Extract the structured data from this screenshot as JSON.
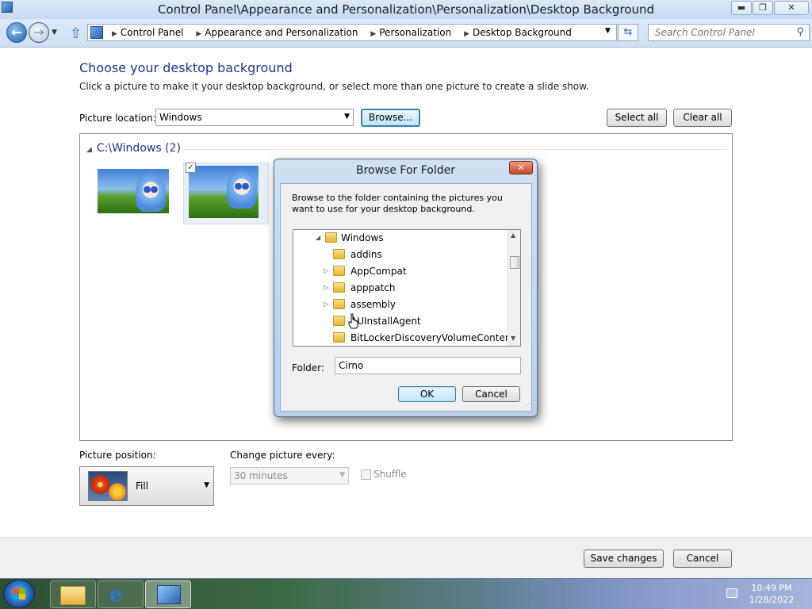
{
  "window": {
    "title": "Control Panel\\Appearance and Personalization\\Personalization\\Desktop Background",
    "min_glyph": "▬",
    "max_glyph": "❐",
    "close_glyph": "✕"
  },
  "nav": {
    "back_glyph": "←",
    "forward_glyph": "→",
    "breadcrumbs": [
      "Control Panel",
      "Appearance and Personalization",
      "Personalization",
      "Desktop Background"
    ],
    "search_placeholder": "Search Control Panel"
  },
  "page": {
    "heading": "Choose your desktop background",
    "subheading": "Click a picture to make it your desktop background, or select more than one picture to create a slide show.",
    "picture_location_label": "Picture location:",
    "picture_location_value": "Windows",
    "browse_label": "Browse...",
    "select_all_label": "Select all",
    "clear_all_label": "Clear all",
    "group_header": "C:\\Windows (2)",
    "picture_position_label": "Picture position:",
    "picture_position_value": "Fill",
    "change_every_label": "Change picture every:",
    "change_every_value": "30 minutes",
    "shuffle_label": "Shuffle",
    "save_label": "Save changes",
    "cancel_label": "Cancel"
  },
  "dialog": {
    "title": "Browse For Folder",
    "close_glyph": "✕",
    "description": "Browse to the folder containing the pictures you want to use for your desktop background.",
    "tree": [
      {
        "label": "Windows",
        "expander": "◢"
      },
      {
        "label": "addins",
        "expander": ""
      },
      {
        "label": "AppCompat",
        "expander": "▷"
      },
      {
        "label": "apppatch",
        "expander": "▷"
      },
      {
        "label": "assembly",
        "expander": "▷"
      },
      {
        "label": "AUInstallAgent",
        "expander": ""
      },
      {
        "label": "BitLockerDiscoveryVolumeContents",
        "expander": ""
      }
    ],
    "folder_label": "Folder:",
    "folder_value": "Cirno",
    "ok_label": "OK",
    "cancel_label": "Cancel"
  },
  "taskbar": {
    "ie_glyph": "e",
    "clock_time": "10:49 PM",
    "clock_date": "1/28/2022"
  },
  "colors": {
    "heading": "#1e3287",
    "accent_button_border": "#3c7fb1",
    "dialog_frame": "#b9cfe8"
  }
}
